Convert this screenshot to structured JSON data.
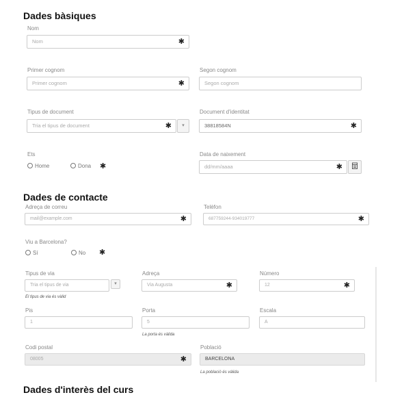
{
  "sections": {
    "basic": "Dades bàsiques",
    "contact": "Dades de contacte",
    "interest": "Dades d'interès del curs"
  },
  "basic": {
    "name_label": "Nom",
    "name_placeholder": "Nom",
    "surname1_label": "Primer cognom",
    "surname1_placeholder": "Primer cognom",
    "surname2_label": "Segon cognom",
    "surname2_placeholder": "Segon cognom",
    "doctype_label": "Tipus de document",
    "doctype_placeholder": "Tria el tipus de document",
    "docid_label": "Document d'identitat",
    "docid_value": "38818584N",
    "gender_label": "Ets",
    "gender_options": [
      "Home",
      "Dona"
    ],
    "birth_label": "Data de naixement",
    "birth_placeholder": "dd/mm/aaaa"
  },
  "contact": {
    "email_label": "Adreça de correu",
    "email_placeholder": "mail@example.com",
    "phone_label": "Telèfon",
    "phone_placeholder": "687759244-934019777",
    "bcn_label": "Viu a Barcelona?",
    "bcn_options": [
      "Sí",
      "No"
    ],
    "streettype_label": "Tipus de via",
    "streettype_placeholder": "Tria el tipus de via",
    "streettype_help": "El tipus de via és vàlid",
    "address_label": "Adreça",
    "address_placeholder": "Via Augusta",
    "number_label": "Número",
    "number_placeholder": "12",
    "floor_label": "Pis",
    "floor_placeholder": "1",
    "door_label": "Porta",
    "door_placeholder": "5",
    "door_help": "La porta és vàlida",
    "stair_label": "Escala",
    "stair_placeholder": "A",
    "postal_label": "Codi postal",
    "postal_value": "08005",
    "city_label": "Població",
    "city_value": "BARCELONA",
    "city_help": "La població és vàlida"
  },
  "required_mark": "✱",
  "caret_glyph": "▾",
  "icons": {
    "calendar": "calendar-icon",
    "caret": "chevron-down-icon",
    "radio": "radio-circle"
  }
}
